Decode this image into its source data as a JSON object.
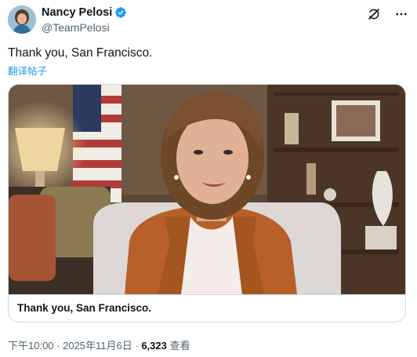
{
  "author": {
    "display_name": "Nancy Pelosi",
    "handle": "@TeamPelosi"
  },
  "icons": {
    "verified": "verified-badge-icon",
    "grok": "grok-icon",
    "more": "more-horizontal-icon"
  },
  "post": {
    "text": "Thank you, San Francisco.",
    "translate_label": "翻译帖子"
  },
  "card": {
    "caption": "Thank you, San Francisco."
  },
  "meta": {
    "time": "下午10:00",
    "sep1": " · ",
    "date": "2025年11月6日",
    "sep2": " · ",
    "views_count": "6,323",
    "views_label": " 查看"
  },
  "colors": {
    "accent": "#1d9bf0",
    "text": "#0f1419",
    "secondary": "#536471",
    "border": "#cfd9de"
  }
}
